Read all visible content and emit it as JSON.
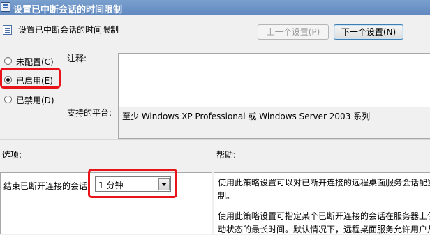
{
  "window": {
    "title": "设置已中断会话的时间限制"
  },
  "header": {
    "policy_name": "设置已中断会话的时间限制"
  },
  "nav": {
    "prev_label": "上一个设置(P)",
    "next_label": "下一个设置(N)"
  },
  "state": {
    "options": [
      {
        "label": "未配置(C)",
        "checked": false
      },
      {
        "label": "已启用(E)",
        "checked": true
      },
      {
        "label": "已禁用(D)",
        "checked": false
      }
    ]
  },
  "comment": {
    "label": "注释:",
    "value": ""
  },
  "platform": {
    "label": "支持的平台:",
    "value": "至少 Windows XP Professional 或 Windows Server 2003 系列"
  },
  "options_section": {
    "label": "选项:",
    "end_session_label": "结束已断开连接的会话",
    "end_session_value": "1 分钟"
  },
  "help_section": {
    "label": "帮助:",
    "lines": [
      "使用此策略设置可以对已断开连接的远程桌面服务会话配置",
      "制。",
      "",
      "使用此策略设置可指定某个已断开连接的会话在服务器上保",
      "动状态的最长时间。默认情况下，远程桌面服务允许用户从"
    ]
  },
  "colors": {
    "highlight": "#e8141a",
    "titlebar": "#6e95c8"
  }
}
